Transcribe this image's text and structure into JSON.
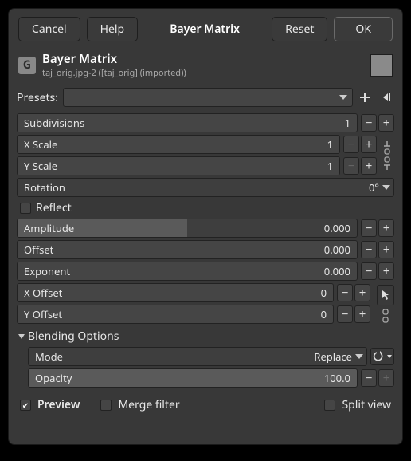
{
  "titlebar": {
    "cancel": "Cancel",
    "help": "Help",
    "title": "Bayer Matrix",
    "reset": "Reset",
    "ok": "OK"
  },
  "header": {
    "title": "Bayer Matrix",
    "subtitle": "taj_orig.jpg-2 ([taj_orig] (imported))"
  },
  "presets_label": "Presets:",
  "sliders": {
    "subdivisions": {
      "label": "Subdivisions",
      "value": "1"
    },
    "xscale": {
      "label": "X Scale",
      "value": "1"
    },
    "yscale": {
      "label": "Y Scale",
      "value": "1"
    },
    "rotation": {
      "label": "Rotation",
      "value": "0°"
    },
    "reflect": {
      "label": "Reflect"
    },
    "amplitude": {
      "label": "Amplitude",
      "value": "0.000"
    },
    "offset": {
      "label": "Offset",
      "value": "0.000"
    },
    "exponent": {
      "label": "Exponent",
      "value": "0.000"
    },
    "xoffset": {
      "label": "X Offset",
      "value": "0"
    },
    "yoffset": {
      "label": "Y Offset",
      "value": "0"
    }
  },
  "blending": {
    "title": "Blending Options",
    "mode_label": "Mode",
    "mode_value": "Replace",
    "opacity_label": "Opacity",
    "opacity_value": "100.0"
  },
  "footer": {
    "preview": "Preview",
    "merge": "Merge filter",
    "split": "Split view"
  }
}
